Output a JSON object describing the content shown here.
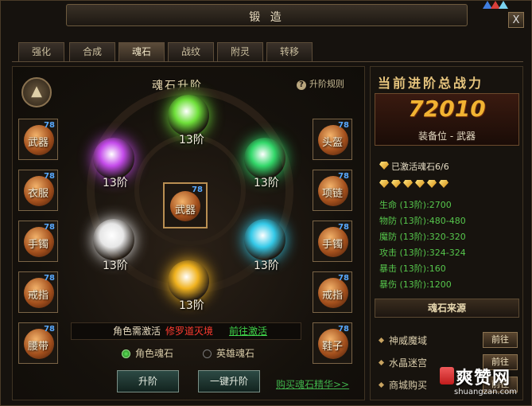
{
  "window": {
    "title": "锻  造",
    "close": "X"
  },
  "tabs": [
    {
      "label": "强化",
      "active": false
    },
    {
      "label": "合成",
      "active": false
    },
    {
      "label": "魂石",
      "active": true
    },
    {
      "label": "战纹",
      "active": false
    },
    {
      "label": "附灵",
      "active": false
    },
    {
      "label": "转移",
      "active": false
    }
  ],
  "soulstone": {
    "section_title": "魂石升阶",
    "help_label": "升阶规则",
    "left_slots": [
      {
        "label": "武器",
        "level": "78"
      },
      {
        "label": "衣服",
        "level": "78"
      },
      {
        "label": "手镯",
        "level": "78"
      },
      {
        "label": "戒指",
        "level": "78"
      },
      {
        "label": "腰带",
        "level": "78"
      }
    ],
    "right_slots": [
      {
        "label": "头盔",
        "level": "78"
      },
      {
        "label": "项链",
        "level": "78"
      },
      {
        "label": "手镯",
        "level": "78"
      },
      {
        "label": "戒指",
        "level": "78"
      },
      {
        "label": "鞋子",
        "level": "78"
      }
    ],
    "center_slot": {
      "label": "武器",
      "level": "78"
    },
    "orbs": [
      {
        "label": "13阶",
        "color": "#6fe03a"
      },
      {
        "label": "13阶",
        "color": "#33d86a"
      },
      {
        "label": "13阶",
        "color": "#34c9e8"
      },
      {
        "label": "13阶",
        "color": "#f0b21e"
      },
      {
        "label": "13阶",
        "color": "#e6e6e6"
      },
      {
        "label": "13阶",
        "color": "#c44bea"
      }
    ],
    "activate": {
      "prefix": "角色需激活",
      "required": "修罗道灭境",
      "link": "前往激活"
    },
    "radio_role": "角色魂石",
    "radio_hero": "英雄魂石",
    "upgrade_button": "升阶",
    "one_key_button": "一键升阶",
    "buy_link": "购买魂石精华>>"
  },
  "power": {
    "title": "当前进阶总战力",
    "value": "72010",
    "equip_position": "装备位 - 武器",
    "activated": "已激活魂石6/6",
    "gem_count": 6,
    "stats": [
      "生命 (13阶):2700",
      "物防 (13阶):480-480",
      "魔防 (13阶):320-320",
      "攻击 (13阶):324-324",
      "暴击 (13阶):160",
      "暴伤 (13阶):1200"
    ]
  },
  "sources": {
    "title": "魂石来源",
    "items": [
      {
        "label": "神威魔域",
        "button": "前往"
      },
      {
        "label": "水晶迷宫",
        "button": "前往"
      },
      {
        "label": "商城购买",
        "button": "前往"
      }
    ]
  },
  "watermark": {
    "brand": "爽赞网",
    "url": "shuangzan.com"
  }
}
